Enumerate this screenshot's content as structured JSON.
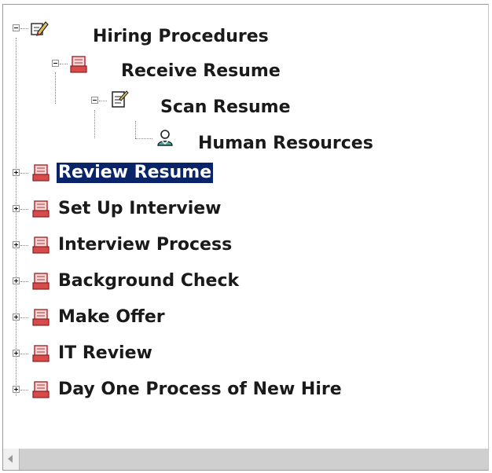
{
  "tree": {
    "root": {
      "label": "Hiring Procedures",
      "icon": "edit-doc-icon"
    },
    "receive": {
      "label": "Receive Resume",
      "icon": "step-icon",
      "scan": {
        "label": "Scan Resume",
        "icon": "checklist-icon",
        "hr": {
          "label": "Human Resources",
          "icon": "user-icon"
        }
      }
    },
    "items": [
      {
        "label": "Review Resume",
        "selected": true
      },
      {
        "label": "Set Up Interview"
      },
      {
        "label": "Interview Process"
      },
      {
        "label": "Background Check"
      },
      {
        "label": "Make Offer"
      },
      {
        "label": "IT Review"
      },
      {
        "label": "Day One Process of New Hire"
      }
    ]
  },
  "colors": {
    "selection": "#0a246a",
    "step_icon": "#c0392b"
  }
}
